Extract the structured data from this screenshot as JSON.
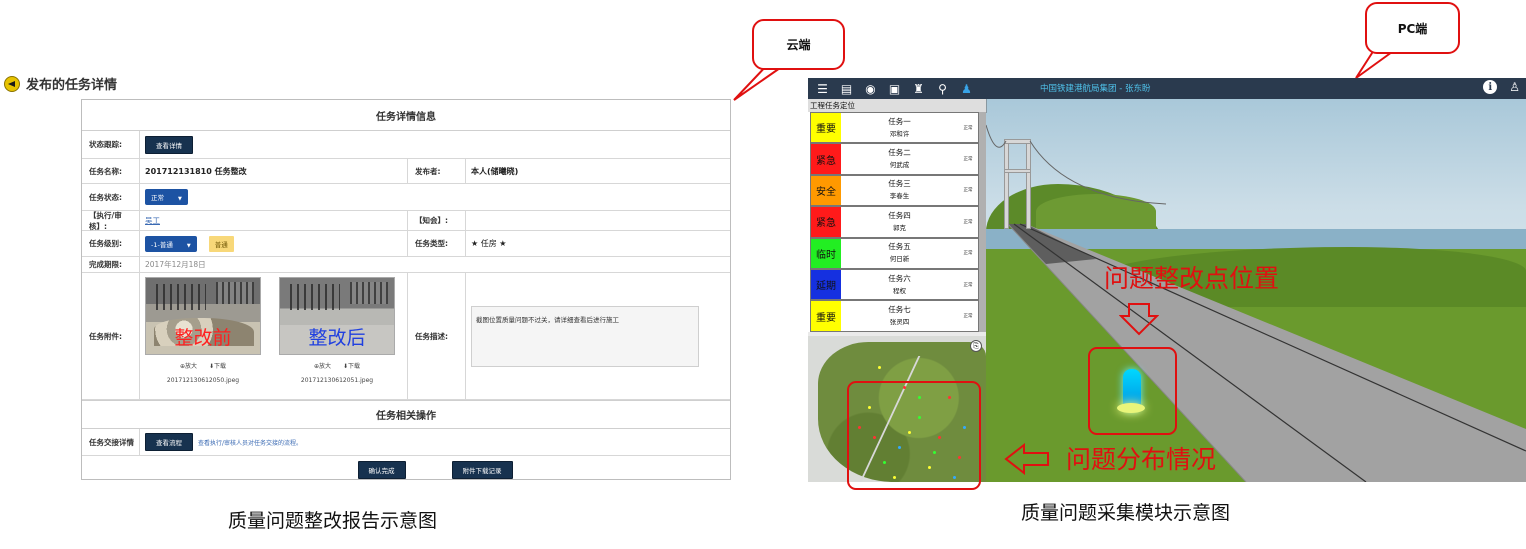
{
  "left": {
    "page_title": "发布的任务详情",
    "section_info": "任务详情信息",
    "section_ops": "任务相关操作",
    "status_label": "状态跟踪:",
    "status_button": "查看详情",
    "name_label": "任务名称:",
    "name_value": "201712131810  任务整改",
    "publisher_label": "发布者:",
    "publisher_value": "本人(储曦晓)",
    "state_label": "任务状态:",
    "state_value": "正常",
    "exec_label": "【执行/审核】:",
    "exec_value": "吴工",
    "cc_label": "【知会】:",
    "level_label": "任务级别:",
    "level_value": "-1-普通",
    "level_tag": "普通",
    "type_label": "任务类型:",
    "type_value": "★ 任房 ★",
    "deadline_label": "完成期限:",
    "deadline_value": "2017年12月18日",
    "attach_label": "任务附件:",
    "photo_before_label": "整改前",
    "photo_after_label": "整改后",
    "zoom_label": "放大",
    "download_label": "下载",
    "file_before": "201712130612050.jpeg",
    "file_after": "201712130612051.jpeg",
    "desc_label": "任务描述:",
    "desc_value": "截图位置质量问题不过关，请详细查看后进行施工",
    "flow_label": "任务交接详情",
    "flow_button": "查看流程",
    "flow_hint": "查看执行/审核人员对任务交接的流程。",
    "confirm_button": "确认完成",
    "download_all_button": "附件下载记录",
    "caption": "质量问题整改报告示意图"
  },
  "callouts": {
    "cloud": "云端",
    "pc": "PC端"
  },
  "right": {
    "org_title": "中国铁建港航局集团 - 张东盼",
    "pane_title": "工程任务定位",
    "tasks": [
      {
        "level": "重要",
        "color": "#ffff00",
        "name": "任务一",
        "assignee": "邓和许",
        "status": "正常"
      },
      {
        "level": "紧急",
        "color": "#ff1a1a",
        "name": "任务二",
        "assignee": "何武成",
        "status": "正常"
      },
      {
        "level": "安全",
        "color": "#ff9900",
        "name": "任务三",
        "assignee": "李春生",
        "status": "正常"
      },
      {
        "level": "紧急",
        "color": "#ff1a1a",
        "name": "任务四",
        "assignee": "郭克",
        "status": "正常"
      },
      {
        "level": "临时",
        "color": "#22ee22",
        "name": "任务五",
        "assignee": "何日新",
        "status": "正常"
      },
      {
        "level": "延期",
        "color": "#1530e0",
        "name": "任务六",
        "assignee": "程权",
        "status": "正常"
      },
      {
        "level": "重要",
        "color": "#ffff00",
        "name": "任务七",
        "assignee": "张灵四",
        "status": "正常"
      }
    ],
    "annot_point": "问题整改点位置",
    "annot_distribution": "问题分布情况",
    "caption": "质量问题采集模块示意图"
  }
}
